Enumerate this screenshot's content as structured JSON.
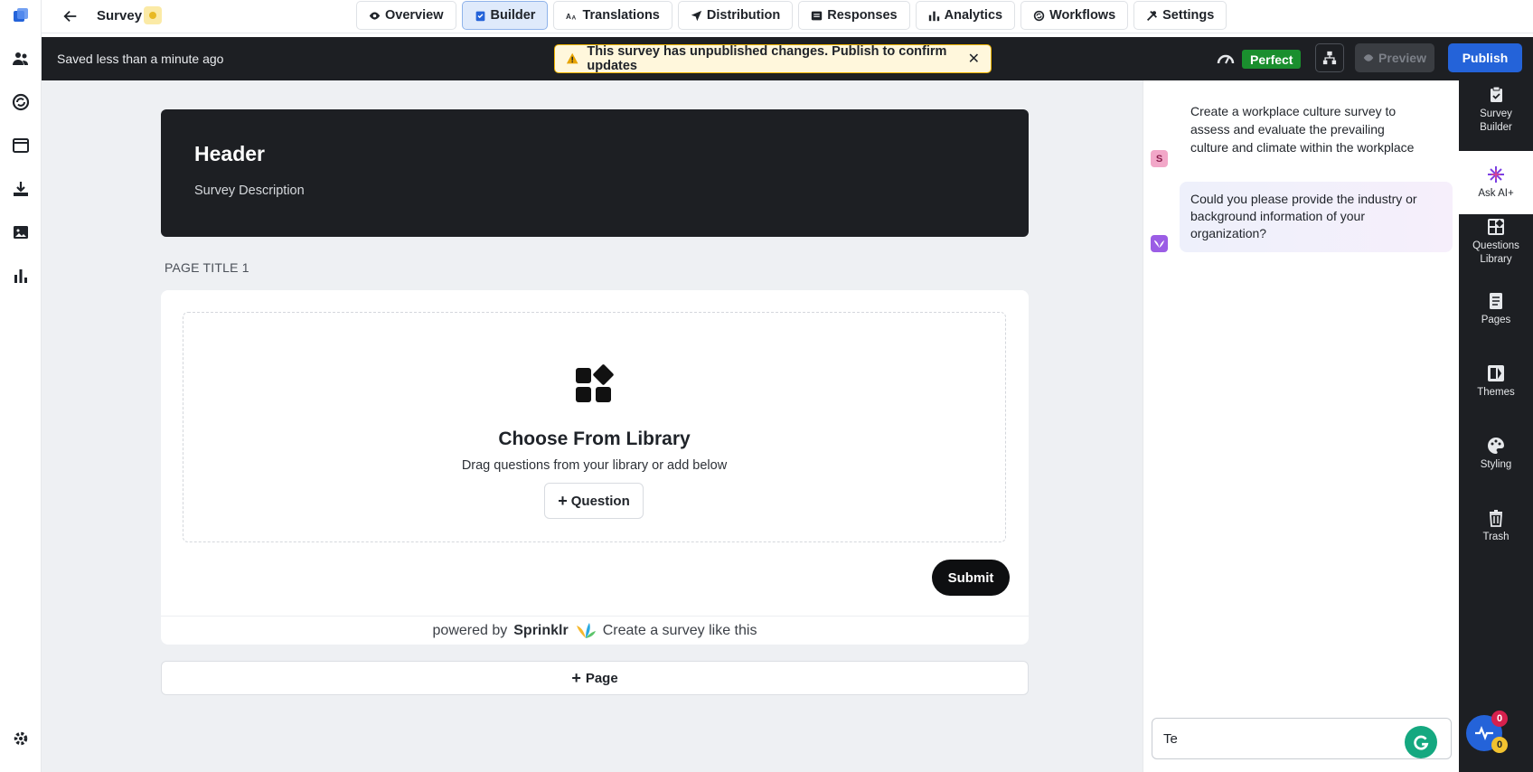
{
  "app": {
    "survey_title": "Survey",
    "tabs": [
      {
        "label": "Overview",
        "icon": "eye-icon"
      },
      {
        "label": "Builder",
        "icon": "clipboard-icon",
        "active": true
      },
      {
        "label": "Translations",
        "icon": "translate-icon"
      },
      {
        "label": "Distribution",
        "icon": "send-icon"
      },
      {
        "label": "Responses",
        "icon": "list-icon"
      },
      {
        "label": "Analytics",
        "icon": "bar-chart-icon"
      },
      {
        "label": "Workflows",
        "icon": "workflow-icon"
      },
      {
        "label": "Settings",
        "icon": "tools-icon"
      }
    ]
  },
  "status": {
    "saved_text": "Saved less than a minute ago",
    "warning_text": "This survey has unpublished changes. Publish to confirm updates",
    "quality_badge": "Perfect",
    "preview_label": "Preview",
    "publish_label": "Publish"
  },
  "canvas": {
    "header_title": "Header",
    "header_description": "Survey Description",
    "page_title": "PAGE TITLE 1",
    "library_title": "Choose From Library",
    "library_subtitle": "Drag questions from your library or add below",
    "question_button": "Question",
    "submit_button": "Submit",
    "powered_prefix": "powered by",
    "powered_brand": "Sprinklr",
    "powered_link": "Create a survey like this",
    "add_page_button": "Page"
  },
  "chat": {
    "user_avatar": "S",
    "user_message": "Create a workplace culture survey to assess and evaluate the prevailing culture and climate within the workplace",
    "ai_message": "Could you please provide the industry or background information of your organization?",
    "input_value": "Te"
  },
  "right_sidebar": {
    "items": [
      {
        "label": "Survey Builder",
        "icon": "clipboard-check-icon"
      },
      {
        "label": "Ask AI+",
        "icon": "sparkle-icon",
        "active": true
      },
      {
        "label": "Questions Library",
        "icon": "library-icon"
      },
      {
        "label": "Pages",
        "icon": "pages-icon"
      },
      {
        "label": "Themes",
        "icon": "themes-icon"
      },
      {
        "label": "Styling",
        "icon": "palette-icon"
      },
      {
        "label": "Trash",
        "icon": "trash-icon"
      }
    ]
  },
  "notifications": {
    "red_count": "0",
    "yellow_count": "0"
  },
  "colors": {
    "accent": "#2463d9",
    "success": "#1a8f2e",
    "warning": "#f0b400",
    "dark": "#1d1f23"
  }
}
